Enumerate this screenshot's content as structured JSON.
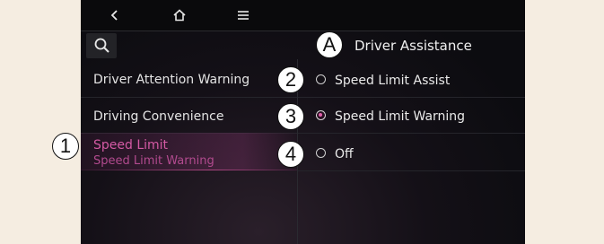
{
  "topbar": {
    "back_icon": "‹",
    "home_icon": "⌂",
    "menu_icon": "≡"
  },
  "header": {
    "title": "Driver Assistance",
    "search_icon": "search-icon"
  },
  "menu": {
    "items": [
      {
        "label": "Driver Attention Warning"
      },
      {
        "label": "Driving Convenience"
      },
      {
        "label": "Speed Limit",
        "sublabel": "Speed Limit Warning",
        "active": true
      }
    ]
  },
  "options": [
    {
      "label": "Speed Limit Assist",
      "checked": false
    },
    {
      "label": "Speed Limit Warning",
      "checked": true
    },
    {
      "label": "Off",
      "checked": false
    }
  ],
  "callouts": {
    "a": "A",
    "one": "1",
    "two": "2",
    "three": "3",
    "four": "4"
  },
  "colors": {
    "accent": "#d45aa4",
    "background": "#0c0c10",
    "page": "#f5ede1"
  }
}
